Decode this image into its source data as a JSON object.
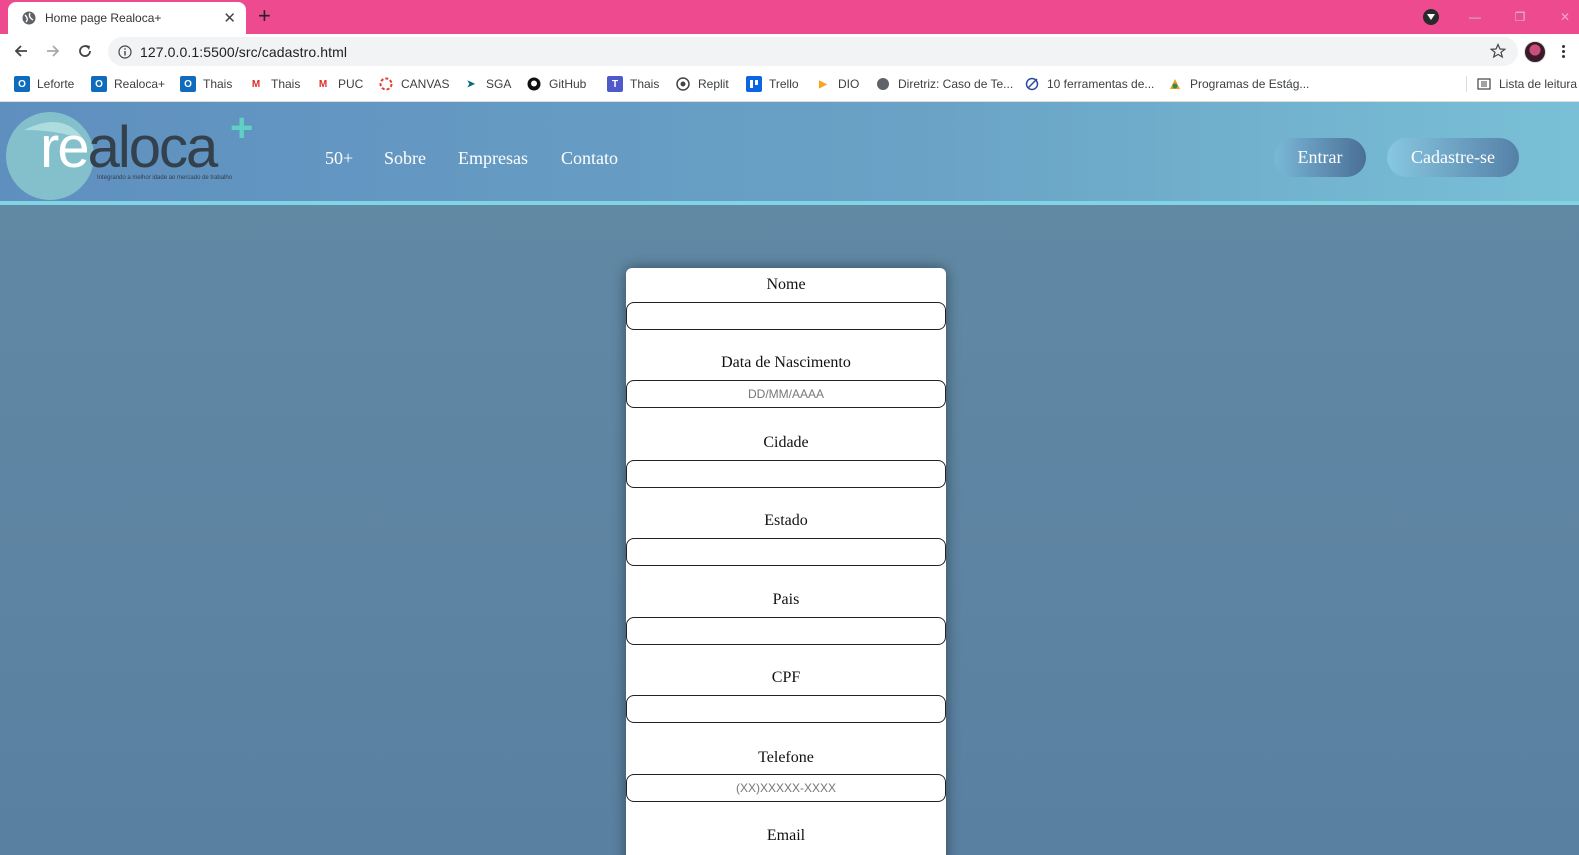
{
  "browser": {
    "tab_title": "Home page Realoca+",
    "url": "127.0.0.1:5500/src/cadastro.html",
    "bookmarks": [
      {
        "label": "Leforte",
        "icon": "outlook-icon"
      },
      {
        "label": "Realoca+",
        "icon": "outlook-icon"
      },
      {
        "label": "Thais",
        "icon": "outlook-icon"
      },
      {
        "label": "Thais",
        "icon": "gmail-icon"
      },
      {
        "label": "PUC",
        "icon": "gmail-icon"
      },
      {
        "label": "CANVAS",
        "icon": "canvas-icon"
      },
      {
        "label": "SGA",
        "icon": "sga-icon"
      },
      {
        "label": "GitHub",
        "icon": "github-icon"
      },
      {
        "label": "Thais",
        "icon": "teams-icon"
      },
      {
        "label": "Replit",
        "icon": "replit-icon"
      },
      {
        "label": "Trello",
        "icon": "trello-icon"
      },
      {
        "label": "DIO",
        "icon": "dio-icon"
      },
      {
        "label": "Diretriz: Caso de Te...",
        "icon": "globe-icon"
      },
      {
        "label": "10 ferramentas de...",
        "icon": "target-icon"
      },
      {
        "label": "Programas de Estág...",
        "icon": "programs-icon"
      }
    ],
    "reading_list": "Lista de leitura",
    "tabbar_color": "#ee4a8f"
  },
  "site": {
    "logo": {
      "re": "re",
      "aloca": "aloca",
      "plus": "+",
      "tagline": "Integrando a melhor idade ao mercado de trabalho"
    },
    "nav": [
      "50+",
      "Sobre",
      "Empresas",
      "Contato"
    ],
    "login_button": "Entrar",
    "signup_button": "Cadastre-se"
  },
  "form": {
    "fields": [
      {
        "label": "Nome",
        "placeholder": ""
      },
      {
        "label": "Data de Nascimento",
        "placeholder": "DD/MM/AAAA"
      },
      {
        "label": "Cidade",
        "placeholder": ""
      },
      {
        "label": "Estado",
        "placeholder": ""
      },
      {
        "label": "Pais",
        "placeholder": ""
      },
      {
        "label": "CPF",
        "placeholder": ""
      },
      {
        "label": "Telefone",
        "placeholder": "(XX)XXXXX-XXXX"
      },
      {
        "label": "Email",
        "placeholder": ""
      }
    ]
  }
}
